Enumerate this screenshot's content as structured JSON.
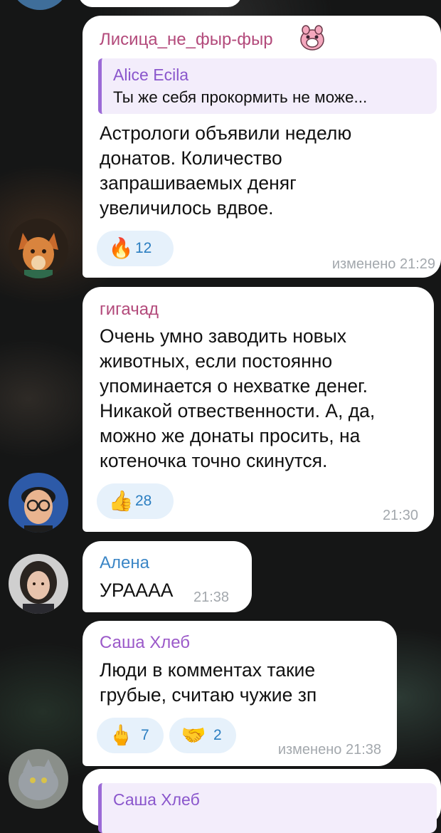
{
  "messages": [
    {
      "sender": "Лисица_не_фыр-фыр",
      "sender_color": "#b34a7b",
      "sender_icon": "pig-sticker-icon",
      "reply": {
        "author": "Alice Ecila",
        "text": "Ты же себя прокормить не може..."
      },
      "text": "Астрологи объявили неделю\nдонатов. Количество\nзапрашиваемых деняг\nувеличилось вдвое.",
      "reactions": [
        {
          "emoji": "🔥",
          "count": "12",
          "icon": "fire-icon"
        }
      ],
      "time": "изменено 21:29",
      "avatar": "fox-avatar"
    },
    {
      "sender": "гигачад",
      "sender_color": "#b34a7b",
      "text": "Очень умно заводить новых\nживотных, если  постоянно\nупоминается о нехватке денег.\nНикакой отвественности. А, да,\nможно же донаты просить, на\nкотеночка точно скинутся.",
      "reactions": [
        {
          "emoji": "👍",
          "count": "28",
          "icon": "thumbs-up-icon"
        }
      ],
      "time": "21:30",
      "avatar": "man-glasses-avatar"
    },
    {
      "sender": "Алена",
      "sender_color": "#3b86c6",
      "text": "УРАААА",
      "time": "21:38",
      "avatar": "woman-avatar"
    },
    {
      "sender": "Саша Хлеб",
      "sender_color": "#9b59c9",
      "text": "Люди в комментах такие\nгрубые, считаю чужие зп",
      "reactions": [
        {
          "emoji": "🖕",
          "count": "7",
          "icon": "middle-finger-icon"
        },
        {
          "emoji": "🤝",
          "count": "2",
          "icon": "handshake-icon"
        }
      ],
      "time": "изменено 21:38",
      "avatar": "cat-avatar"
    },
    {
      "sender": "Саша Хлеб",
      "sender_color": "#9b59c9"
    }
  ]
}
